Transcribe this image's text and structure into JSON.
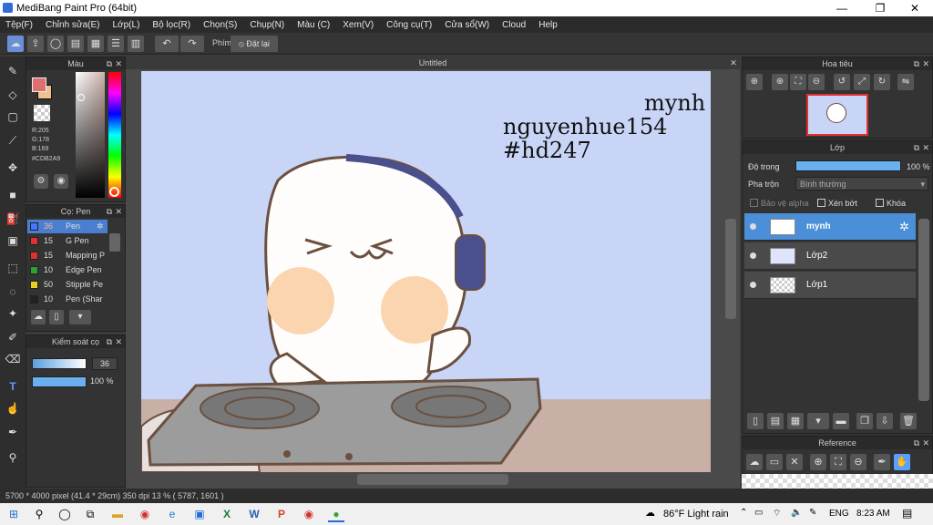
{
  "window": {
    "title": "MediBang Paint Pro (64bit)",
    "minimize": "—",
    "maximize": "❐",
    "close": "✕"
  },
  "menu": [
    "Tệp(F)",
    "Chỉnh sửa(E)",
    "Lớp(L)",
    "Bộ lọc(R)",
    "Chọn(S)",
    "Chụp(N)",
    "Màu (C)",
    "Xem(V)",
    "Công cụ(T)",
    "Cửa sổ(W)",
    "Cloud",
    "Help"
  ],
  "toolbar": {
    "shortcut_label": "Phím",
    "reset_label": "Đặt lại"
  },
  "color_panel": {
    "title": "Màu",
    "r": "R:205",
    "g": "G:178",
    "b": "B:169",
    "hex": "#CDB2A9",
    "fg": "#e07070",
    "bg": "#f0c090"
  },
  "brush_panel": {
    "title": "Cọ: Pen",
    "items": [
      {
        "size": "36",
        "name": "Pen",
        "color": "#4477ff"
      },
      {
        "size": "15",
        "name": "G Pen",
        "color": "#e03030"
      },
      {
        "size": "15",
        "name": "Mapping P",
        "color": "#e03030"
      },
      {
        "size": "10",
        "name": "Edge Pen",
        "color": "#30a030"
      },
      {
        "size": "50",
        "name": "Stipple Pe",
        "color": "#e8d020"
      },
      {
        "size": "10",
        "name": "Pen (Shar",
        "color": "#222222"
      }
    ]
  },
  "brush_control": {
    "title": "Kiểm soát cọ",
    "size": "36",
    "opacity": "100 %"
  },
  "canvas": {
    "tab": "Untitled",
    "lines": [
      "mynh",
      "nguyenhue154",
      "#hd247"
    ]
  },
  "navigator": {
    "title": "Hoa tiêu"
  },
  "layer_panel": {
    "title": "Lớp",
    "opacity_label": "Độ trong",
    "opacity_value": "100 %",
    "blend_label": "Pha trộn",
    "blend_value": "Bình thường",
    "protect_alpha": "Bảo vệ alpha",
    "clip": "Xén bớt",
    "lock": "Khóa",
    "layers": [
      "mynh",
      "Lớp2",
      "Lớp1"
    ]
  },
  "reference": {
    "title": "Reference"
  },
  "status": {
    "text": "5700 * 4000 pixel   (41.4 * 29cm)   350 dpi   13 %   ( 5787, 1601 )"
  },
  "taskbar": {
    "weather": "86°F  Light rain",
    "lang": "ENG",
    "time": "8:23 AM"
  }
}
